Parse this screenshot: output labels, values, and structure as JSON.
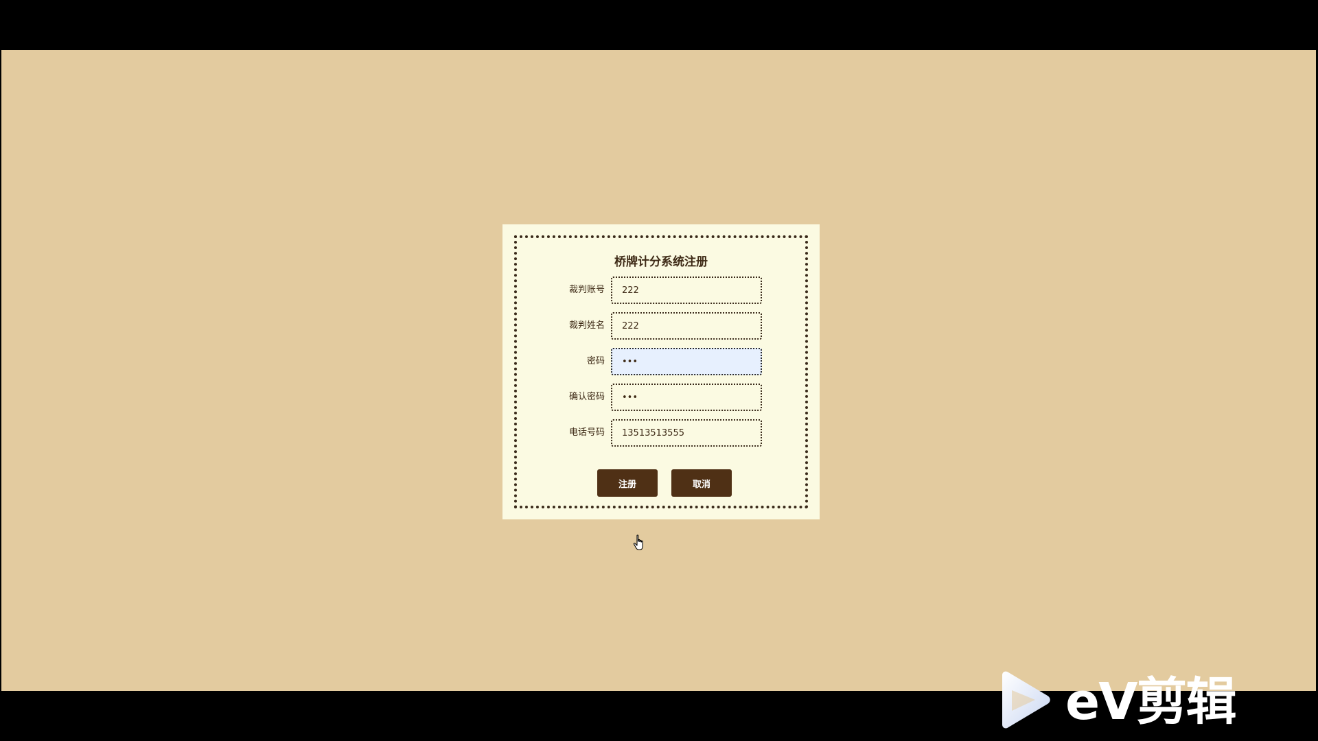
{
  "form": {
    "title": "桥牌计分系统注册",
    "fields": [
      {
        "label": "裁判账号",
        "value": "222",
        "type": "text"
      },
      {
        "label": "裁判姓名",
        "value": "222",
        "type": "text"
      },
      {
        "label": "密码",
        "value": "123",
        "type": "password"
      },
      {
        "label": "确认密码",
        "value": "123",
        "type": "password"
      },
      {
        "label": "电话号码",
        "value": "13513513555",
        "type": "text"
      }
    ],
    "register_label": "注册",
    "cancel_label": "取消"
  },
  "watermark": {
    "text": "eV剪辑"
  },
  "colors": {
    "page_background": "#e3cb9f",
    "card_background": "#fbfae2",
    "button_background": "#4f3015",
    "focused_input_background": "#e7f0fe"
  }
}
